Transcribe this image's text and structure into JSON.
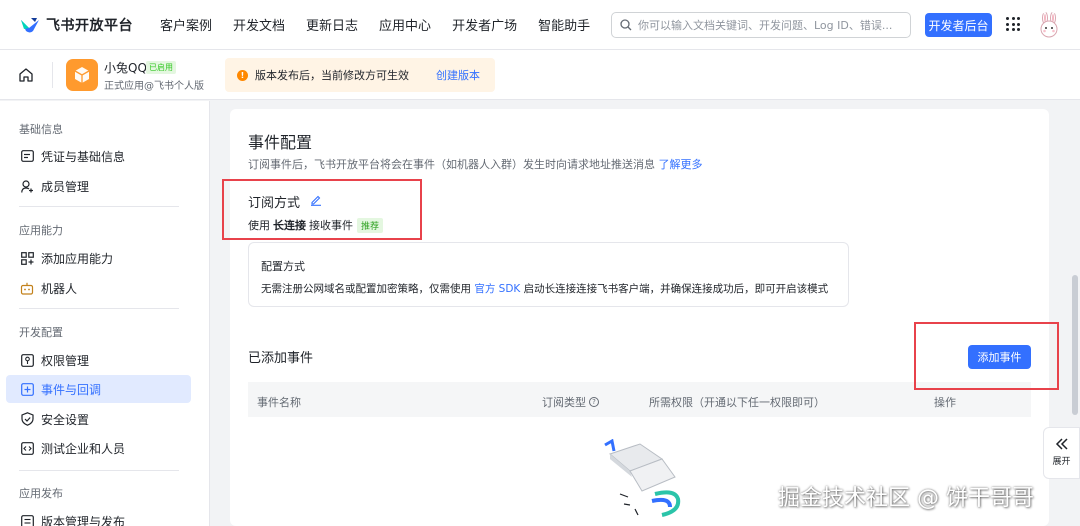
{
  "header": {
    "brand": "飞书开放平台",
    "nav": [
      "客户案例",
      "开发文档",
      "更新日志",
      "应用中心",
      "开发者广场",
      "智能助手"
    ],
    "search_placeholder": "你可以输入文档关键词、开发问题、Log ID、错误...",
    "dev_console_label": "开发者后台"
  },
  "app": {
    "name": "小兔QQ",
    "status_badge": "已启用",
    "subtitle": "正式应用@飞书个人版",
    "notice": "版本发布后，当前修改方可生效",
    "notice_link": "创建版本"
  },
  "sidebar": {
    "sections": [
      {
        "title": "基础信息",
        "items": [
          {
            "label": "凭证与基础信息",
            "icon": "id-card-icon"
          },
          {
            "label": "成员管理",
            "icon": "user-add-icon"
          }
        ]
      },
      {
        "title": "应用能力",
        "items": [
          {
            "label": "添加应用能力",
            "icon": "apps-add-icon"
          },
          {
            "label": "机器人",
            "icon": "robot-icon"
          }
        ]
      },
      {
        "title": "开发配置",
        "items": [
          {
            "label": "权限管理",
            "icon": "permission-icon"
          },
          {
            "label": "事件与回调",
            "icon": "event-icon",
            "active": true
          },
          {
            "label": "安全设置",
            "icon": "shield-icon"
          },
          {
            "label": "测试企业和人员",
            "icon": "code-icon"
          }
        ]
      },
      {
        "title": "应用发布",
        "items": [
          {
            "label": "版本管理与发布",
            "icon": "version-icon"
          }
        ]
      }
    ]
  },
  "main": {
    "title": "事件配置",
    "description": "订阅事件后，飞书开放平台将会在事件（如机器人入群）发生时向请求地址推送消息",
    "learn_more": "了解更多",
    "subscribe_title": "订阅方式",
    "method_prefix": "使用",
    "method_bold": "长连接",
    "method_suffix": "接收事件",
    "recommend_badge": "推荐",
    "config_card": {
      "title": "配置方式",
      "desc_prefix": "无需注册公网域名或配置加密策略，仅需使用",
      "desc_link": "官方 SDK",
      "desc_suffix": "启动长连接连接飞书客户端，并确保连接成功后，即可开启该模式"
    },
    "added_title": "已添加事件",
    "add_button": "添加事件",
    "table_headers": [
      "事件名称",
      "订阅类型",
      "所需权限（开通以下任一权限即可）",
      "操作"
    ]
  },
  "expand_label": "展开",
  "watermark": "掘金技术社区 @ 饼干哥哥",
  "colors": {
    "accent": "#3370ff",
    "highlight": "#e8424b",
    "app_icon": "#ff9a2e",
    "notice_bg": "#fff4e5"
  }
}
